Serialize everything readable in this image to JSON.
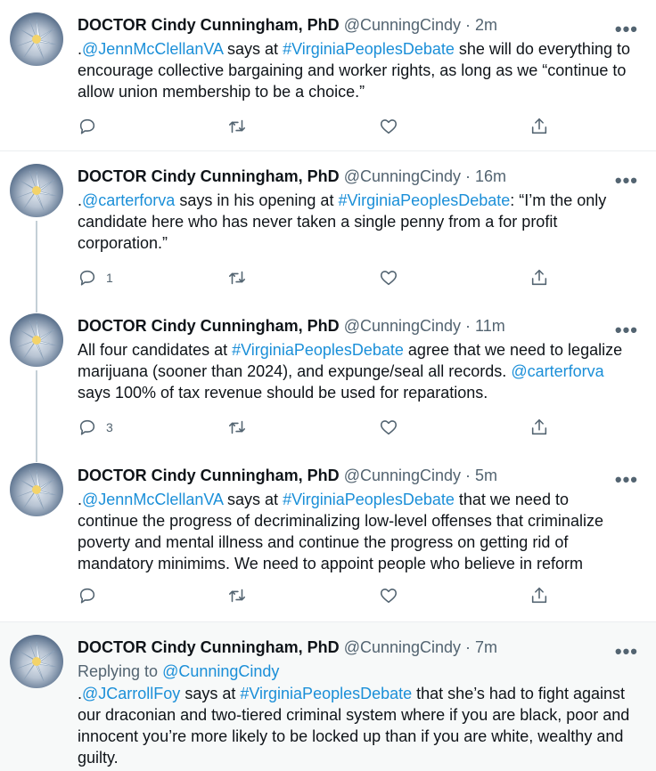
{
  "tweets": [
    {
      "name": "DOCTOR Cindy Cunningham, PhD",
      "handle": "@CunningCindy",
      "dot": " · ",
      "time": "2m",
      "more": "•••",
      "segments": [
        {
          "text": ".",
          "link": false
        },
        {
          "text": "@JennMcClellanVA",
          "link": true
        },
        {
          "text": " says at ",
          "link": false
        },
        {
          "text": "#VirginiaPeoplesDebate",
          "link": true
        },
        {
          "text": " she will do everything to encourage collective bargaining and worker rights, as long as we “continue to allow union membership to be a choice.”",
          "link": false
        }
      ],
      "reply_count": ""
    },
    {
      "name": "DOCTOR Cindy Cunningham, PhD",
      "handle": "@CunningCindy",
      "dot": " · ",
      "time": "16m",
      "more": "•••",
      "segments": [
        {
          "text": ".",
          "link": false
        },
        {
          "text": "@carterforva",
          "link": true
        },
        {
          "text": " says in his opening at ",
          "link": false
        },
        {
          "text": "#VirginiaPeoplesDebate",
          "link": true
        },
        {
          "text": ": “I’m the only candidate here who has never taken a single penny from a for profit corporation.”",
          "link": false
        }
      ],
      "reply_count": "1"
    },
    {
      "name": "DOCTOR Cindy Cunningham, PhD",
      "handle": "@CunningCindy",
      "dot": " · ",
      "time": "11m",
      "more": "•••",
      "segments": [
        {
          "text": "All four candidates at ",
          "link": false
        },
        {
          "text": "#VirginiaPeoplesDebate",
          "link": true
        },
        {
          "text": " agree that we need to legalize marijuana (sooner than 2024), and expunge/seal all records. ",
          "link": false
        },
        {
          "text": "@carterforva",
          "link": true
        },
        {
          "text": " says 100% of tax revenue should be used for reparations.",
          "link": false
        }
      ],
      "reply_count": "3"
    },
    {
      "name": "DOCTOR Cindy Cunningham, PhD",
      "handle": "@CunningCindy",
      "dot": " · ",
      "time": "5m",
      "more": "•••",
      "segments": [
        {
          "text": ".",
          "link": false
        },
        {
          "text": "@JennMcClellanVA",
          "link": true
        },
        {
          "text": " says at ",
          "link": false
        },
        {
          "text": "#VirginiaPeoplesDebate",
          "link": true
        },
        {
          "text": " that we need to continue the progress of decriminalizing low-level offenses that criminalize poverty and mental illness and continue the progress on getting rid of mandatory minimims. We need to appoint people who believe in reform",
          "link": false
        }
      ],
      "reply_count": ""
    },
    {
      "name": "DOCTOR Cindy Cunningham, PhD",
      "handle": "@CunningCindy",
      "dot": " · ",
      "time": "7m",
      "more": "•••",
      "replying_label": "Replying to ",
      "replying_handle": "@CunningCindy",
      "segments": [
        {
          "text": ".",
          "link": false
        },
        {
          "text": "@JCarrollFoy",
          "link": true
        },
        {
          "text": " says at ",
          "link": false
        },
        {
          "text": "#VirginiaPeoplesDebate",
          "link": true
        },
        {
          "text": " that she’s had to fight against our draconian and two-tiered criminal system where if you are black, poor and innocent you’re more likely to be locked up than if you are white, wealthy and guilty.",
          "link": false
        }
      ],
      "reply_count": ""
    }
  ],
  "colors": {
    "link": "#1b8fd8",
    "secondary_text": "#536471",
    "thread_line": "#c4cfd6",
    "highlight_bg": "#f7f9f9"
  },
  "icons": [
    "reply-icon",
    "retweet-icon",
    "like-icon",
    "share-icon",
    "more-icon",
    "avatar"
  ]
}
